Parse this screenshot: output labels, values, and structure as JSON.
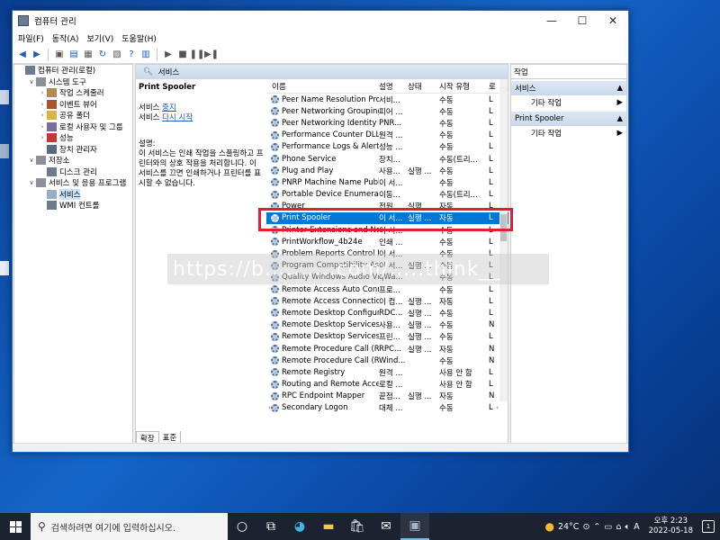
{
  "window": {
    "title": "컴퓨터 관리",
    "controls": {
      "minimize": "—",
      "maximize": "☐",
      "close": "✕"
    }
  },
  "menu": [
    "파일(F)",
    "동작(A)",
    "보기(V)",
    "도움말(H)"
  ],
  "tree": {
    "nodes": [
      {
        "label": "컴퓨터 관리(로컬)",
        "indent": 0,
        "exp": "",
        "icon": "computer-management-icon",
        "color": "#6a7b93"
      },
      {
        "label": "시스템 도구",
        "indent": 1,
        "exp": "∨",
        "icon": "system-tools-icon",
        "color": "#8a8f98"
      },
      {
        "label": "작업 스케줄러",
        "indent": 2,
        "exp": "›",
        "icon": "task-scheduler-icon",
        "color": "#b08b4a"
      },
      {
        "label": "이벤트 뷰어",
        "indent": 2,
        "exp": "›",
        "icon": "event-viewer-icon",
        "color": "#a9542d"
      },
      {
        "label": "공유 폴더",
        "indent": 2,
        "exp": "›",
        "icon": "shared-folders-icon",
        "color": "#d9b44a"
      },
      {
        "label": "로컬 사용자 및 그룹",
        "indent": 2,
        "exp": "›",
        "icon": "users-groups-icon",
        "color": "#7c6b9e"
      },
      {
        "label": "성능",
        "indent": 2,
        "exp": "›",
        "icon": "performance-icon",
        "color": "#c03a3a"
      },
      {
        "label": "장치 관리자",
        "indent": 2,
        "exp": "",
        "icon": "device-manager-icon",
        "color": "#5a6a80"
      },
      {
        "label": "저장소",
        "indent": 1,
        "exp": "∨",
        "icon": "storage-icon",
        "color": "#8a8f98"
      },
      {
        "label": "디스크 관리",
        "indent": 2,
        "exp": "",
        "icon": "disk-management-icon",
        "color": "#6c7a8a"
      },
      {
        "label": "서비스 및 응용 프로그램",
        "indent": 1,
        "exp": "∨",
        "icon": "services-apps-icon",
        "color": "#8a8f98"
      },
      {
        "label": "서비스",
        "indent": 2,
        "exp": "",
        "icon": "services-icon",
        "color": "#9aacc3",
        "selected": true
      },
      {
        "label": "WMI 컨트롤",
        "indent": 2,
        "exp": "",
        "icon": "wmi-control-icon",
        "color": "#6c7a8a"
      }
    ]
  },
  "center": {
    "header": "서비스",
    "detail": {
      "service_name": "Print Spooler",
      "stop_prefix": "서비스 ",
      "stop_link": "중지",
      "restart_prefix": "서비스 ",
      "restart_link": "다시 시작",
      "desc_label": "설명:",
      "description": "이 서비스는 인쇄 작업을 스풀링하고 프린터와의 상호 작용을 처리합니다. 이 서비스를 끄면 인쇄하거나 프린터를 표시할 수 없습니다."
    },
    "columns": {
      "name": "이름",
      "desc": "설명",
      "state": "상태",
      "startup": "시작 유형",
      "logon": "로"
    },
    "rows": [
      {
        "name": "Peer Name Resolution Prot...",
        "desc": "서비...",
        "state": "",
        "startup": "수동",
        "logon": "L"
      },
      {
        "name": "Peer Networking Grouping",
        "desc": "피어 ...",
        "state": "",
        "startup": "수동",
        "logon": "L"
      },
      {
        "name": "Peer Networking Identity ...",
        "desc": "PNR...",
        "state": "",
        "startup": "수동",
        "logon": "L"
      },
      {
        "name": "Performance Counter DLL ...",
        "desc": "원격 ...",
        "state": "",
        "startup": "수동",
        "logon": "L"
      },
      {
        "name": "Performance Logs & Alerts",
        "desc": "성능 ...",
        "state": "",
        "startup": "수동",
        "logon": "L"
      },
      {
        "name": "Phone Service",
        "desc": "장치...",
        "state": "",
        "startup": "수동(트리...",
        "logon": "L"
      },
      {
        "name": "Plug and Play",
        "desc": "사용...",
        "state": "실행 ...",
        "startup": "수동",
        "logon": "L"
      },
      {
        "name": "PNRP Machine Name Publi...",
        "desc": "이 서...",
        "state": "",
        "startup": "수동",
        "logon": "L"
      },
      {
        "name": "Portable Device Enumerato...",
        "desc": "이동...",
        "state": "",
        "startup": "수동(트리...",
        "logon": "L"
      },
      {
        "name": "Power",
        "desc": "전원 ...",
        "state": "실행 ...",
        "startup": "자동",
        "logon": "L"
      },
      {
        "name": "Print Spooler",
        "desc": "이 서...",
        "state": "실행 ...",
        "startup": "자동",
        "logon": "L",
        "selected": true
      },
      {
        "name": "Printer Extensions and Noti...",
        "desc": "이 서...",
        "state": "",
        "startup": "수동",
        "logon": "L"
      },
      {
        "name": "PrintWorkflow_4b24e",
        "desc": "인쇄 ...",
        "state": "",
        "startup": "수동",
        "logon": "L"
      },
      {
        "name": "Problem Reports Control P...",
        "desc": "이 서...",
        "state": "",
        "startup": "수동",
        "logon": "L"
      },
      {
        "name": "Program Compatibility Assi...",
        "desc": "이 서...",
        "state": "실행 ...",
        "startup": "수동",
        "logon": "L"
      },
      {
        "name": "Quality Windows Audio Vi...",
        "desc": "qWa...",
        "state": "",
        "startup": "수동",
        "logon": "L"
      },
      {
        "name": "Remote Access Auto Conn...",
        "desc": "프로...",
        "state": "",
        "startup": "수동",
        "logon": "L"
      },
      {
        "name": "Remote Access Connection...",
        "desc": "이 컴...",
        "state": "실행 ...",
        "startup": "자동",
        "logon": "L"
      },
      {
        "name": "Remote Desktop Configura...",
        "desc": "RDC...",
        "state": "실행 ...",
        "startup": "수동",
        "logon": "L"
      },
      {
        "name": "Remote Desktop Services",
        "desc": "사용...",
        "state": "실행 ...",
        "startup": "수동",
        "logon": "N"
      },
      {
        "name": "Remote Desktop Services ...",
        "desc": "프린...",
        "state": "실행 ...",
        "startup": "수동",
        "logon": "L"
      },
      {
        "name": "Remote Procedure Call (RP...",
        "desc": "RPC...",
        "state": "실행 ...",
        "startup": "자동",
        "logon": "N"
      },
      {
        "name": "Remote Procedure Call (RP...",
        "desc": "Wind...",
        "state": "",
        "startup": "수동",
        "logon": "N"
      },
      {
        "name": "Remote Registry",
        "desc": "원격 ...",
        "state": "",
        "startup": "사용 안 함",
        "logon": "L"
      },
      {
        "name": "Routing and Remote Access",
        "desc": "로컬 ...",
        "state": "",
        "startup": "사용 안 함",
        "logon": "L"
      },
      {
        "name": "RPC Endpoint Mapper",
        "desc": "끝점...",
        "state": "실행 ...",
        "startup": "자동",
        "logon": "N"
      },
      {
        "name": "Secondary Logon",
        "desc": "대체 ...",
        "state": "",
        "startup": "수동",
        "logon": "L"
      }
    ],
    "tabs": [
      "확장",
      "표준"
    ]
  },
  "actions": {
    "title": "작업",
    "sections": [
      {
        "label": "서비스",
        "item": "기타 작업"
      },
      {
        "label": "Print Spooler",
        "item": "기타 작업"
      }
    ]
  },
  "watermark": "https://b..........com/.....think__",
  "taskbar": {
    "search_placeholder": "검색하려면 여기에 입력하십시오.",
    "weather": "24°C",
    "ime": "A",
    "time": "오후 2:23",
    "date": "2022-05-18",
    "notification_count": "1"
  },
  "colors": {
    "selection": "#0078d7",
    "highlight_box": "#e02030",
    "desktop": "#1565c8"
  }
}
